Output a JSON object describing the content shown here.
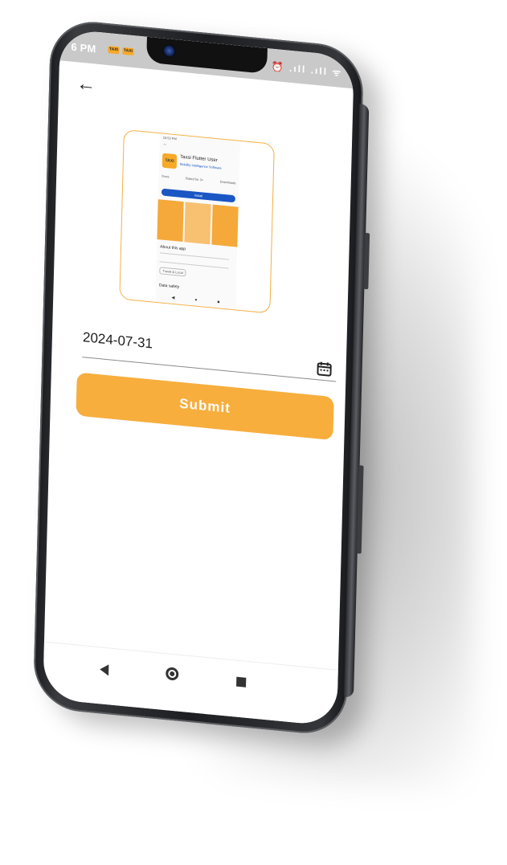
{
  "status_bar": {
    "time": "6 PM",
    "notification_badges": [
      "TAXI",
      "TAXI"
    ],
    "right_icons": "⏰ .ıll .ıll ᯤ"
  },
  "toolbar": {
    "back_icon": "arrow-left-icon"
  },
  "preview_image": {
    "status_time": "10:52 PM",
    "app_logo_text": "TAXI",
    "app_title": "Taxsi Flutter User",
    "app_subtitle": "Mobility Intelligence Software",
    "stats": [
      "Docs",
      "Rated for 3+",
      "Downloads"
    ],
    "install_label": "Install",
    "about_title": "About this app",
    "tag_label": "Travel & Local",
    "data_safety": "Data safety"
  },
  "form": {
    "date_value": "2024-07-31",
    "calendar_icon": "calendar-icon",
    "submit_label": "Submit"
  },
  "colors": {
    "accent": "#f7ae3d",
    "border_accent": "#f5b042"
  },
  "nav_bar": {
    "icons": [
      "back-triangle-icon",
      "home-circle-icon",
      "recents-square-icon"
    ]
  }
}
